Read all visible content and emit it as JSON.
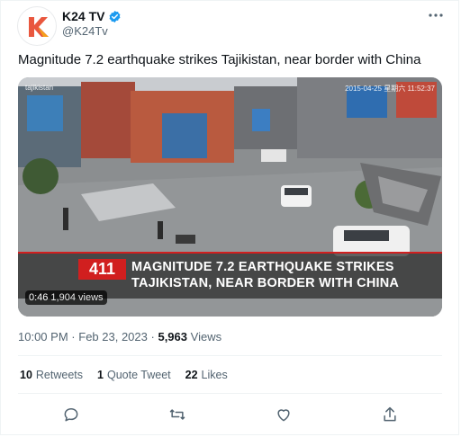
{
  "author": {
    "name": "K24 TV",
    "handle": "@K24Tv",
    "verified": true,
    "more_icon": "more-horizontal-icon"
  },
  "tweet": {
    "text": "Magnitude 7.2 earthquake strikes Tajikistan, near border with China"
  },
  "media": {
    "type": "video",
    "overlay": {
      "stamp_left": "tajikistan",
      "stamp_right": "2015-04-25 星期六 11:52:37",
      "badge": "411",
      "headline_line1": "MAGNITUDE 7.2 EARTHQUAKE STRIKES",
      "headline_line2": "TAJIKISTAN, NEAR BORDER WITH CHINA"
    },
    "duration": "0:46",
    "views": "1,904 views"
  },
  "meta": {
    "time": "10:00 PM",
    "dot": "·",
    "date": "Feb 23, 2023",
    "dot2": "·",
    "views_count": "5,963",
    "views_label": "Views"
  },
  "stats": {
    "retweets_count": "10",
    "retweets_label": "Retweets",
    "quotes_count": "1",
    "quotes_label": "Quote Tweet",
    "likes_count": "22",
    "likes_label": "Likes"
  },
  "actions": [
    "reply-icon",
    "retweet-icon",
    "like-icon",
    "share-icon"
  ],
  "colors": {
    "brand_verified": "#1d9bf0",
    "banner_red": "#d11f1f",
    "muted_text": "#536471",
    "primary_text": "#0f1419"
  }
}
